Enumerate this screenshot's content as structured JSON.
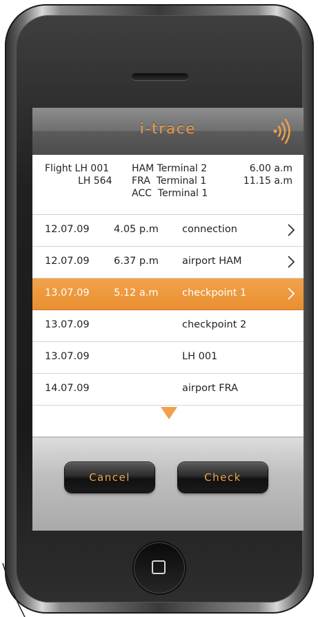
{
  "app": {
    "title": "i-trace",
    "accent_color": "#f0a04a",
    "signal_icon": "wireless-signal-icon"
  },
  "flight_info": {
    "rows": [
      {
        "flight": "Flight LH 001",
        "origin": "HAM Terminal 2",
        "time": "6.00 a.m"
      },
      {
        "flight": "LH 564",
        "origin": "FRA  Terminal 1",
        "time": "11.15 a.m"
      },
      {
        "flight": "",
        "origin": "ACC  Terminal 1",
        "time": ""
      }
    ]
  },
  "tracking": {
    "rows": [
      {
        "date": "12.07.09",
        "time": "4.05 p.m",
        "event": "connection",
        "has_detail": true,
        "selected": false
      },
      {
        "date": "12.07.09",
        "time": "6.37 p.m",
        "event": "airport HAM",
        "has_detail": true,
        "selected": false
      },
      {
        "date": "13.07.09",
        "time": "5.12 a.m",
        "event": "checkpoint 1",
        "has_detail": true,
        "selected": true
      },
      {
        "date": "13.07.09",
        "time": "",
        "event": "checkpoint 2",
        "has_detail": false,
        "selected": false
      },
      {
        "date": "13.07.09",
        "time": "",
        "event": "LH 001",
        "has_detail": false,
        "selected": false
      },
      {
        "date": "14.07.09",
        "time": "",
        "event": "airport FRA",
        "has_detail": false,
        "selected": false
      }
    ],
    "more_icon": "down-triangle-icon"
  },
  "buttons": {
    "cancel_label": "Cancel",
    "check_label": "Check"
  },
  "device": {
    "home_icon": "home-button-icon"
  }
}
